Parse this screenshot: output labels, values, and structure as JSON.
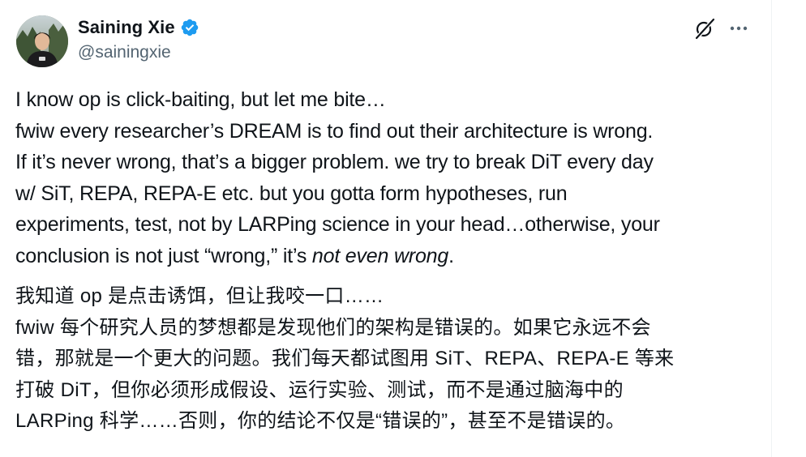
{
  "author": {
    "name": "Saining Xie",
    "handle": "@sainingxie",
    "verified": true,
    "avatar_icon": "avatar-photo"
  },
  "actions": {
    "grok_icon": "grok-icon",
    "more_icon": "more-horizontal-icon"
  },
  "colors": {
    "text": "#0f1419",
    "secondary": "#536471",
    "verified_blue": "#1d9bf0",
    "divider": "#eff3f4"
  },
  "tweet": {
    "en": {
      "line1": "I know op is click-baiting, but let me bite…",
      "line2": "fwiw every researcher’s DREAM is to find out their architecture is wrong.",
      "line3": "If it’s never wrong, that’s a bigger problem. we try to break DiT every day",
      "line4": "w/ SiT, REPA, REPA-E etc. but you gotta form hypotheses, run",
      "line5": "experiments, test, not by LARPing science in your head…otherwise, your",
      "line6_a": "conclusion is not just “wrong,” it’s ",
      "line6_em": "not even wrong",
      "line6_b": "."
    },
    "zh": {
      "line1": "我知道 op 是点击诱饵，但让我咬一口……",
      "line2": "fwiw 每个研究人员的梦想都是发现他们的架构是错误的。如果它永远不会",
      "line3": "错，那就是一个更大的问题。我们每天都试图用 SiT、REPA、REPA-E 等来",
      "line4": "打破 DiT，但你必须形成假设、运行实验、测试，而不是通过脑海中的",
      "line5": "LARPing 科学……否则，你的结论不仅是“错误的”，甚至不是错误的。"
    }
  }
}
